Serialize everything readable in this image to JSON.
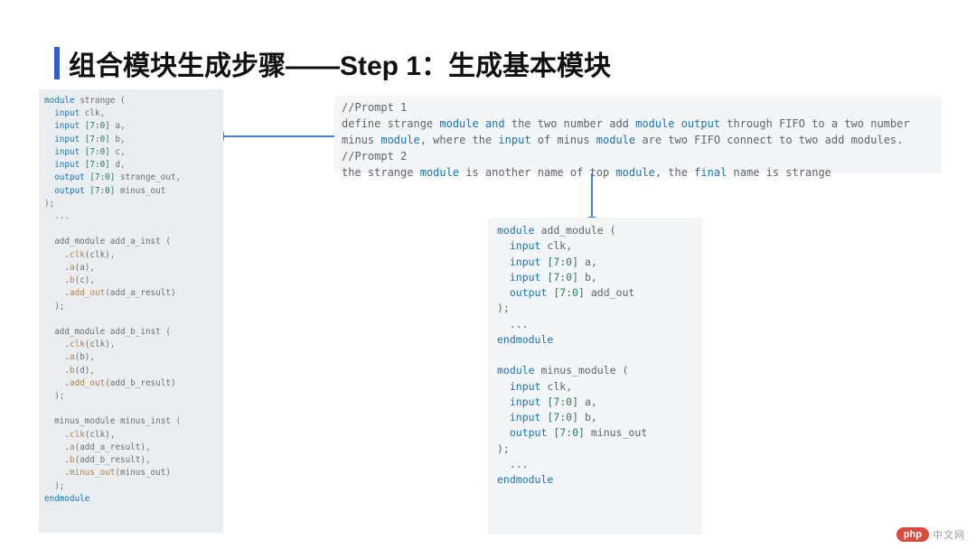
{
  "heading": {
    "title": "组合模块生成步骤——Step 1：生成基本模块"
  },
  "prompt": {
    "c1": "//Prompt 1",
    "l1a": "define strange ",
    "l1b": "module and",
    "l1c": " the two number add ",
    "l1d": "module output",
    "l1e": " through FIFO to a two number",
    "l2a": "minus ",
    "l2b": "module",
    "l2c": ", where the ",
    "l2d": "input",
    "l2e": " of minus ",
    "l2f": "module",
    "l2g": " are two FIFO connect to two add modules.",
    "c2": "//Prompt 2",
    "l3a": "the strange ",
    "l3b": "module",
    "l3c": " is another name of top ",
    "l3d": "module",
    "l3e": ", the ",
    "l3f": "final",
    "l3g": " name is strange"
  },
  "left": {
    "l01a": "module",
    "l01b": " strange (",
    "l02a": "  input",
    "l02b": " clk,",
    "l03a": "  input ",
    "l03r": "[7:0]",
    "l03b": " a,",
    "l04a": "  input ",
    "l04r": "[7:0]",
    "l04b": " b,",
    "l05a": "  input ",
    "l05r": "[7:0]",
    "l05b": " c,",
    "l06a": "  input ",
    "l06r": "[7:0]",
    "l06b": " d,",
    "l07a": "  output ",
    "l07r": "[7:0]",
    "l07b": " strange_out,",
    "l08a": "  output ",
    "l08r": "[7:0]",
    "l08b": " minus_out",
    "l09": ");",
    "l10": "  ...",
    "blank": " ",
    "a1": "  add_module add_a_inst (",
    "a2a": "    .",
    "a2m": "clk",
    "a2b": "(clk),",
    "a3a": "    .",
    "a3m": "a",
    "a3b": "(a),",
    "a4a": "    .",
    "a4m": "b",
    "a4b": "(c),",
    "a5a": "    .",
    "a5m": "add_out",
    "a5b": "(add_a_result)",
    "a6": "  );",
    "b1": "  add_module add_b_inst (",
    "b2a": "    .",
    "b2m": "clk",
    "b2b": "(clk),",
    "b3a": "    .",
    "b3m": "a",
    "b3b": "(b),",
    "b4a": "    .",
    "b4m": "b",
    "b4b": "(d),",
    "b5a": "    .",
    "b5m": "add_out",
    "b5b": "(add_b_result)",
    "b6": "  );",
    "m1": "  minus_module minus_inst (",
    "m2a": "    .",
    "m2m": "clk",
    "m2b": "(clk),",
    "m3a": "    .",
    "m3m": "a",
    "m3b": "(add_a_result),",
    "m4a": "    .",
    "m4m": "b",
    "m4b": "(add_b_result),",
    "m5a": "    .",
    "m5m": "minus_out",
    "m5b": "(minus_out)",
    "m6": "  );",
    "end": "endmodule"
  },
  "right": {
    "a01a": "module",
    "a01b": " add_module (",
    "a02a": "  input",
    "a02b": " clk,",
    "a03a": "  input ",
    "a03r": "[7:0]",
    "a03b": " a,",
    "a04a": "  input ",
    "a04r": "[7:0]",
    "a04b": " b,",
    "a05a": "  output ",
    "a05r": "[7:0]",
    "a05b": " add_out",
    "a06": ");",
    "a07": "  ...",
    "a08": "endmodule",
    "b01a": "module",
    "b01b": " minus_module (",
    "b02a": "  input",
    "b02b": " clk,",
    "b03a": "  input ",
    "b03r": "[7:0]",
    "b03b": " a,",
    "b04a": "  input ",
    "b04r": "[7:0]",
    "b04b": " b,",
    "b05a": "  output ",
    "b05r": "[7:0]",
    "b05b": " minus_out",
    "b06": ");",
    "b07": "  ...",
    "b08": "endmodule"
  },
  "watermark": {
    "pill": "php",
    "text": "中文网"
  }
}
